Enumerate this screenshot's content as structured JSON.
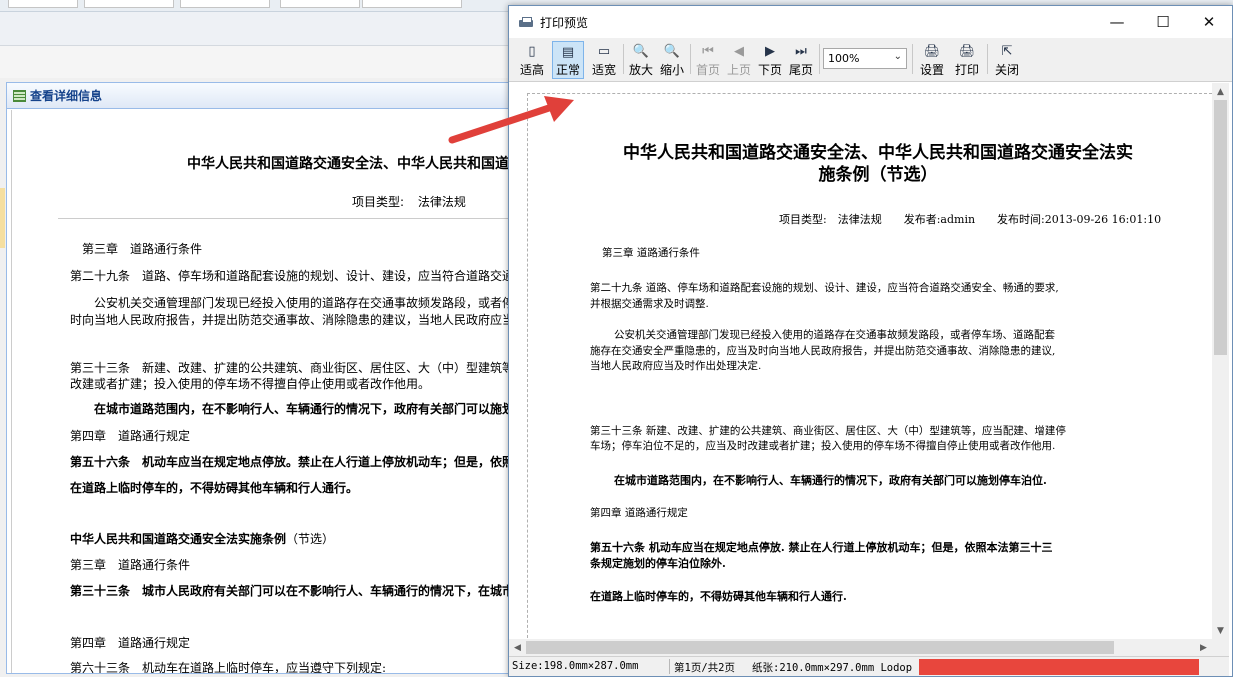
{
  "detail_panel": {
    "header": "查看详细信息",
    "title": "中华人民共和国道路交通安全法、中华人民共和国道",
    "meta_label": "项目类型:",
    "meta_value": "法律法规",
    "lines": [
      {
        "text": "第三章　道路通行条件",
        "bold": false
      },
      {
        "text": "第二十九条　道路、停车场和道路配套设施的规划、设计、建设，应当符合道路交通安",
        "bold": false
      },
      {
        "text": "公安机关交通管理部门发现已经投入使用的道路存在交通事故频发路段，或者停",
        "bold": false
      },
      {
        "text": "时向当地人民政府报告，并提出防范交通事故、消除隐患的建议，当地人民政府应当",
        "bold": false
      },
      {
        "text": "第三十三条　新建、改建、扩建的公共建筑、商业街区、居住区、大（中）型建筑等",
        "bold": false
      },
      {
        "text": "改建或者扩建；投入使用的停车场不得擅自停止使用或者改作他用。",
        "bold": false
      },
      {
        "text": "在城市道路范围内，在不影响行人、车辆通行的情况下，政府有关部门可以施划",
        "bold": true
      },
      {
        "text": "第四章　道路通行规定",
        "bold": false
      },
      {
        "text": "第五十六条　机动车应当在规定地点停放。禁止在人行道上停放机动车；但是，依照",
        "bold": true
      },
      {
        "text": "在道路上临时停车的，不得妨碍其他车辆和行人通行。",
        "bold": true
      },
      {
        "text": "中华人民共和国道路交通安全法实施条例",
        "bold": true
      },
      {
        "text": "（节选）",
        "bold": false
      },
      {
        "text": "第三章　道路通行条件",
        "bold": false
      },
      {
        "text": "第三十三条　城市人民政府有关部门可以在不影响行人、车辆通行的情况下，在城市",
        "bold": true
      },
      {
        "text": "第四章　道路通行规定",
        "bold": false
      },
      {
        "text": "第六十三条　机动车在道路上临时停车，应当遵守下列规定:",
        "bold": false
      }
    ]
  },
  "preview": {
    "window_title": "打印预览",
    "window_buttons": {
      "minimize": "—",
      "maximize": "☐",
      "close": "✕"
    },
    "toolbar": {
      "fit_height": "适高",
      "normal": "正常",
      "fit_width": "适宽",
      "zoom_in": "放大",
      "zoom_out": "缩小",
      "first_page": "首页",
      "prev_page": "上页",
      "next_page": "下页",
      "last_page": "尾页",
      "zoom_value": "100%",
      "settings": "设置",
      "print": "打印",
      "close": "关闭"
    },
    "icons": {
      "fit_height": "▯",
      "normal": "▤",
      "fit_width": "▭",
      "zoom_in": "🔍",
      "zoom_out": "🔍",
      "first_page": "⏮",
      "prev_page": "◀",
      "next_page": "▶",
      "last_page": "⏭",
      "settings": "🖨",
      "print": "🖨",
      "close": "⇱",
      "zoom_chevron": "⌄",
      "scroll_up": "▲",
      "scroll_down": "▼",
      "scroll_left": "◀",
      "scroll_right": "▶"
    },
    "page": {
      "title_line1": "中华人民共和国道路交通安全法、中华人民共和国道路交通安全法实",
      "title_line2": "施条例（节选）",
      "meta": "项目类型:　法律法规　　发布者:admin　　发布时间:2013-09-26 16:01:10",
      "lines": [
        {
          "text": "第三章 道路通行条件",
          "bold": false
        },
        {
          "text": "第二十九条 道路、停车场和道路配套设施的规划、设计、建设，应当符合道路交通安全、畅通的要求,",
          "bold": false
        },
        {
          "text": "并根据交通需求及时调整.",
          "bold": false
        },
        {
          "text": "公安机关交通管理部门发现已经投入使用的道路存在交通事故频发路段，或者停车场、道路配套",
          "bold": false
        },
        {
          "text": "施存在交通安全严重隐患的，应当及时向当地人民政府报告，并提出防范交通事故、消除隐患的建议,",
          "bold": false
        },
        {
          "text": "当地人民政府应当及时作出处理决定.",
          "bold": false
        },
        {
          "text": "第三十三条 新建、改建、扩建的公共建筑、商业街区、居住区、大（中）型建筑等，应当配建、增建停",
          "bold": false
        },
        {
          "text": "车场；停车泊位不足的，应当及时改建或者扩建；投入使用的停车场不得擅自停止使用或者改作他用.",
          "bold": false
        },
        {
          "text": "在城市道路范围内，在不影响行人、车辆通行的情况下，政府有关部门可以施划停车泊位.",
          "bold": true
        },
        {
          "text": "第四章 道路通行规定",
          "bold": false
        },
        {
          "text": "第五十六条 机动车应当在规定地点停放. 禁止在人行道上停放机动车；但是，依照本法第三十三",
          "bold": true
        },
        {
          "text": "条规定施划的停车泊位除外.",
          "bold": true
        },
        {
          "text": "在道路上临时停车的，不得妨碍其他车辆和行人通行.",
          "bold": true
        }
      ]
    },
    "status": {
      "size": "Size:198.0mm×287.0mm",
      "page": "第1页/共2页",
      "paper": "纸张:210.0mm×297.0mm Lodop"
    }
  },
  "colors": {
    "arrow": "#e0403a",
    "redaction": "#e8463d",
    "panel_border": "#99bbe8",
    "active_tool": "#cce4f7"
  }
}
